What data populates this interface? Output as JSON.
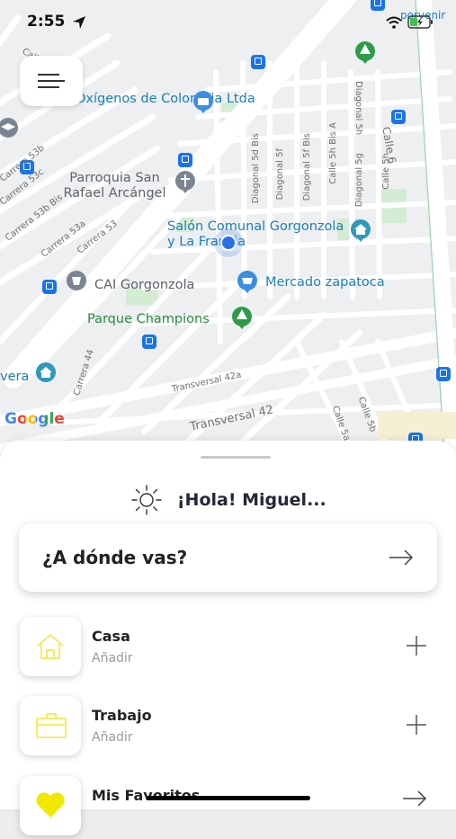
{
  "status_bar": {
    "time": "2:55"
  },
  "map": {
    "pois": [
      {
        "name": "Oxígenos de Colombia Ltda"
      },
      {
        "name": "Parroquia San Rafael Arcángel"
      },
      {
        "name": "Salón Comunal Gorgonzola y La Francia"
      },
      {
        "name": "CAI Gorgonzola"
      },
      {
        "name": "Mercado zapatoca"
      },
      {
        "name": "Parque Champions"
      }
    ],
    "streets": [
      "Calle 6",
      "Diagonal 5h",
      "Diagonal 5d Bis",
      "Diagonal 5f",
      "Diagonal 5f Bis",
      "Calle 5h Bis A",
      "Diagonal 5g",
      "Calle 5h",
      "Carrera 53c",
      "Carrera 53b Bis",
      "Carrera 53a",
      "Carrera 53",
      "Carrera 53b",
      "Transversal 42a",
      "Transversal 42",
      "Carrera 44",
      "Calle 5a",
      "Calle 5b",
      "Calle"
    ],
    "partial_labels": [
      "porvenir",
      "vera"
    ],
    "attribution": "Google"
  },
  "sheet": {
    "greeting": "¡Hola! Miguel...",
    "destination_prompt": "¿A dónde vas?",
    "saved_places": [
      {
        "title": "Casa",
        "subtitle": "Añadir",
        "icon": "house-icon",
        "action_icon": "plus-icon"
      },
      {
        "title": "Trabajo",
        "subtitle": "Añadir",
        "icon": "briefcase-icon",
        "action_icon": "plus-icon"
      },
      {
        "title": "Mis Favoritos",
        "subtitle": "",
        "icon": "heart-icon",
        "action_icon": "arrow-right-icon"
      }
    ]
  },
  "colors": {
    "accent_yellow": "#f1ea5a",
    "poi_blue": "#1c7fb8",
    "park_green": "#2d8a3f",
    "location_blue": "#2b6fe8"
  }
}
